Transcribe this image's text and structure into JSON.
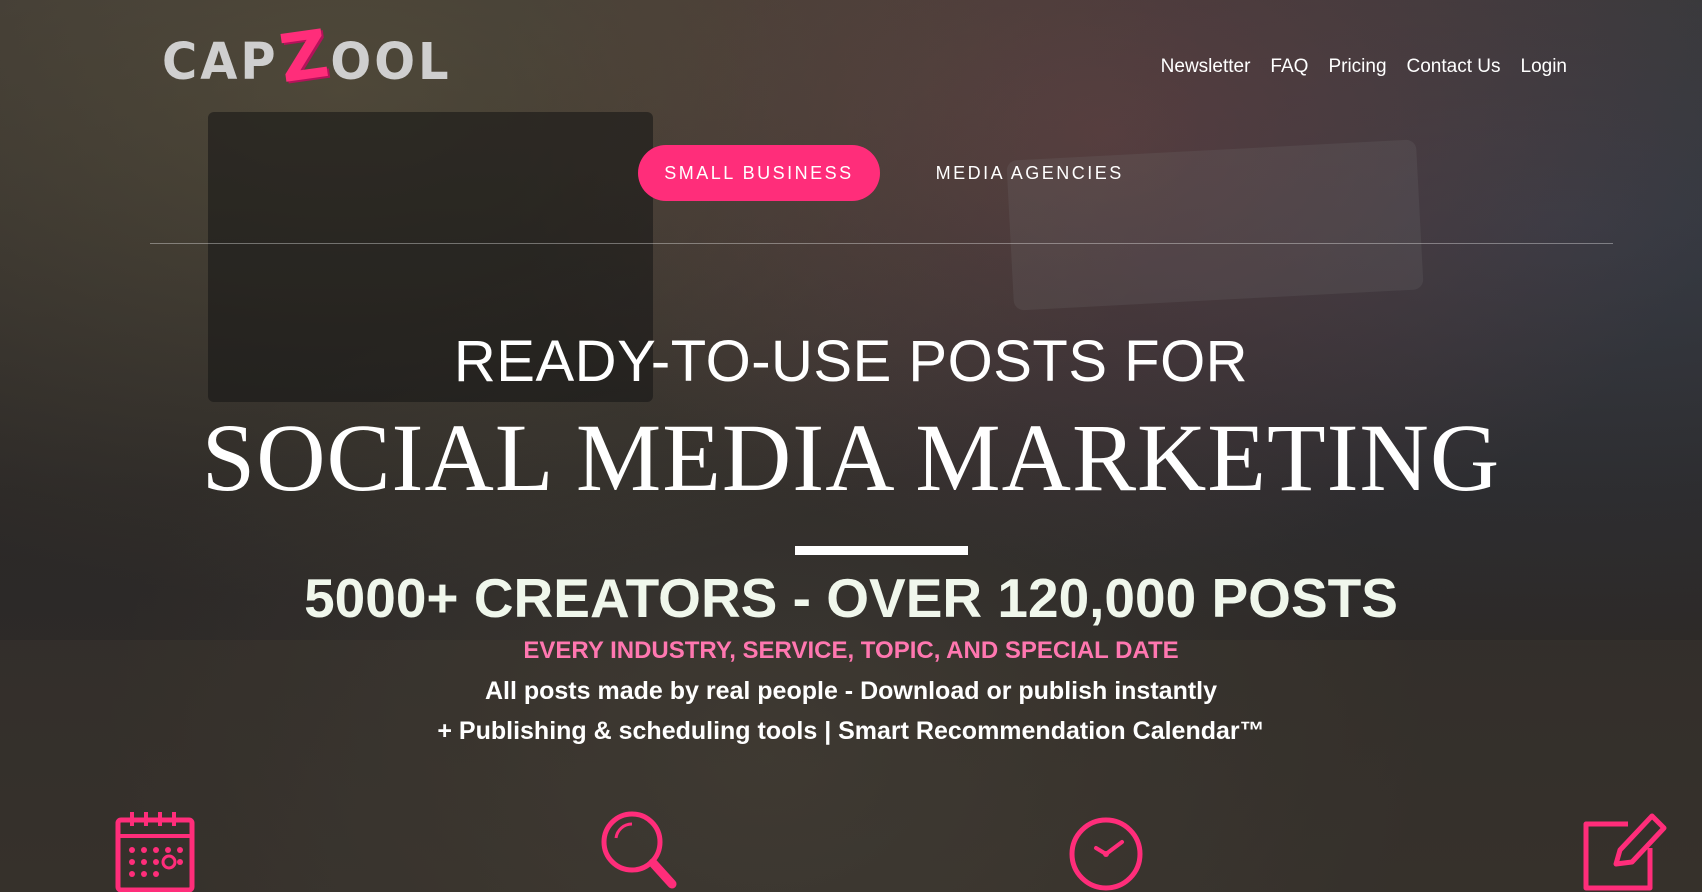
{
  "brand": {
    "logo_part1": "CAP",
    "logo_z": "Z",
    "logo_part2": "OOL",
    "accent_color": "#ff2d7a"
  },
  "nav": {
    "items": [
      {
        "label": "Newsletter"
      },
      {
        "label": "FAQ"
      },
      {
        "label": "Pricing"
      },
      {
        "label": "Contact Us"
      },
      {
        "label": "Login"
      }
    ]
  },
  "audience_tabs": [
    {
      "label": "SMALL BUSINESS",
      "active": true
    },
    {
      "label": "MEDIA AGENCIES",
      "active": false
    }
  ],
  "hero": {
    "headline_line1": "READY-TO-USE POSTS FOR",
    "headline_line2": "SOCIAL MEDIA MARKETING",
    "stats": "5000+ CREATORS - OVER 120,000 POSTS",
    "tagline_pink": "EVERY INDUSTRY, SERVICE, TOPIC, AND SPECIAL DATE",
    "tagline_1": "All posts made by real people - Download or publish instantly",
    "tagline_2": "+ Publishing & scheduling tools | Smart Recommendation Calendar™"
  },
  "features": [
    {
      "icon": "calendar-icon"
    },
    {
      "icon": "search-icon"
    },
    {
      "icon": "clock-icon"
    },
    {
      "icon": "edit-icon"
    }
  ]
}
